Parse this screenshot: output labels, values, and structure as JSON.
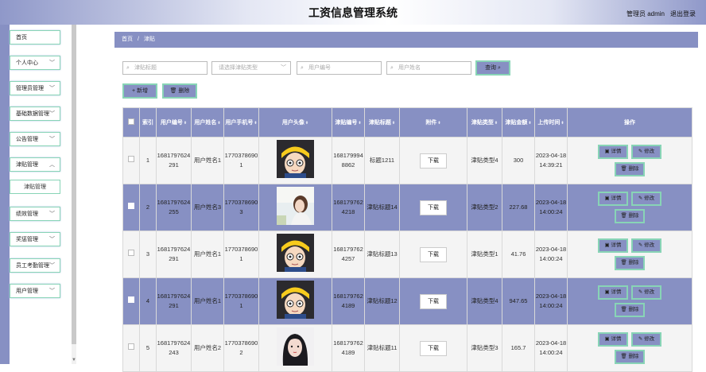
{
  "header": {
    "title": "工资信息管理系统",
    "admin_label": "管理员 admin",
    "logout_label": "退出登录"
  },
  "sidebar": {
    "items": [
      {
        "label": "首页"
      },
      {
        "label": "个人中心"
      },
      {
        "label": "管理员管理"
      },
      {
        "label": "基础数据管理"
      },
      {
        "label": "公告管理"
      },
      {
        "label": "津贴管理"
      },
      {
        "label": "绩效管理"
      },
      {
        "label": "奖惩管理"
      },
      {
        "label": "员工考勤管理"
      },
      {
        "label": "用户管理"
      }
    ],
    "sub_item": "津贴管理"
  },
  "breadcrumb": {
    "home": "首页",
    "sep": "/",
    "current": "津贴"
  },
  "search": {
    "title_placeholder": "津贴标题",
    "type_placeholder": "请选择津贴类型",
    "user_no_placeholder": "用户编号",
    "user_name_placeholder": "用户姓名",
    "query_label": "查询"
  },
  "actions": {
    "add_label": "+ 新增",
    "delete_label": "删除"
  },
  "table": {
    "headers": [
      "索引",
      "用户编号",
      "用户姓名",
      "用户手机号",
      "用户头像",
      "津贴编号",
      "津贴标题",
      "附件",
      "津贴类型",
      "津贴金额",
      "上传时间",
      "操作"
    ],
    "download_label": "下载",
    "detail_label": "详情",
    "edit_label": "修改",
    "delete_label": "删除",
    "rows": [
      {
        "index": "1",
        "user_no": "1681797624291",
        "user_name": "用户姓名1",
        "phone": "17703786901",
        "allowance_no": "1681799948862",
        "title": "标题1211",
        "type": "津贴类型4",
        "amount": "300",
        "time": "2023-04-18 14:39:21"
      },
      {
        "index": "2",
        "user_no": "1681797624255",
        "user_name": "用户姓名3",
        "phone": "17703786903",
        "allowance_no": "1681797624218",
        "title": "津贴标题14",
        "type": "津贴类型2",
        "amount": "227.68",
        "time": "2023-04-18 14:00:24"
      },
      {
        "index": "3",
        "user_no": "1681797624291",
        "user_name": "用户姓名1",
        "phone": "17703786901",
        "allowance_no": "1681797624257",
        "title": "津贴标题13",
        "type": "津贴类型1",
        "amount": "41.76",
        "time": "2023-04-18 14:00:24"
      },
      {
        "index": "4",
        "user_no": "1681797624291",
        "user_name": "用户姓名1",
        "phone": "17703786901",
        "allowance_no": "1681797624189",
        "title": "津贴标题12",
        "type": "津贴类型4",
        "amount": "947.65",
        "time": "2023-04-18 14:00:24"
      },
      {
        "index": "5",
        "user_no": "1681797624243",
        "user_name": "用户姓名2",
        "phone": "17703786902",
        "allowance_no": "1681797624189",
        "title": "津贴标题11",
        "type": "津贴类型3",
        "amount": "165.7",
        "time": "2023-04-18 14:00:24"
      }
    ]
  }
}
